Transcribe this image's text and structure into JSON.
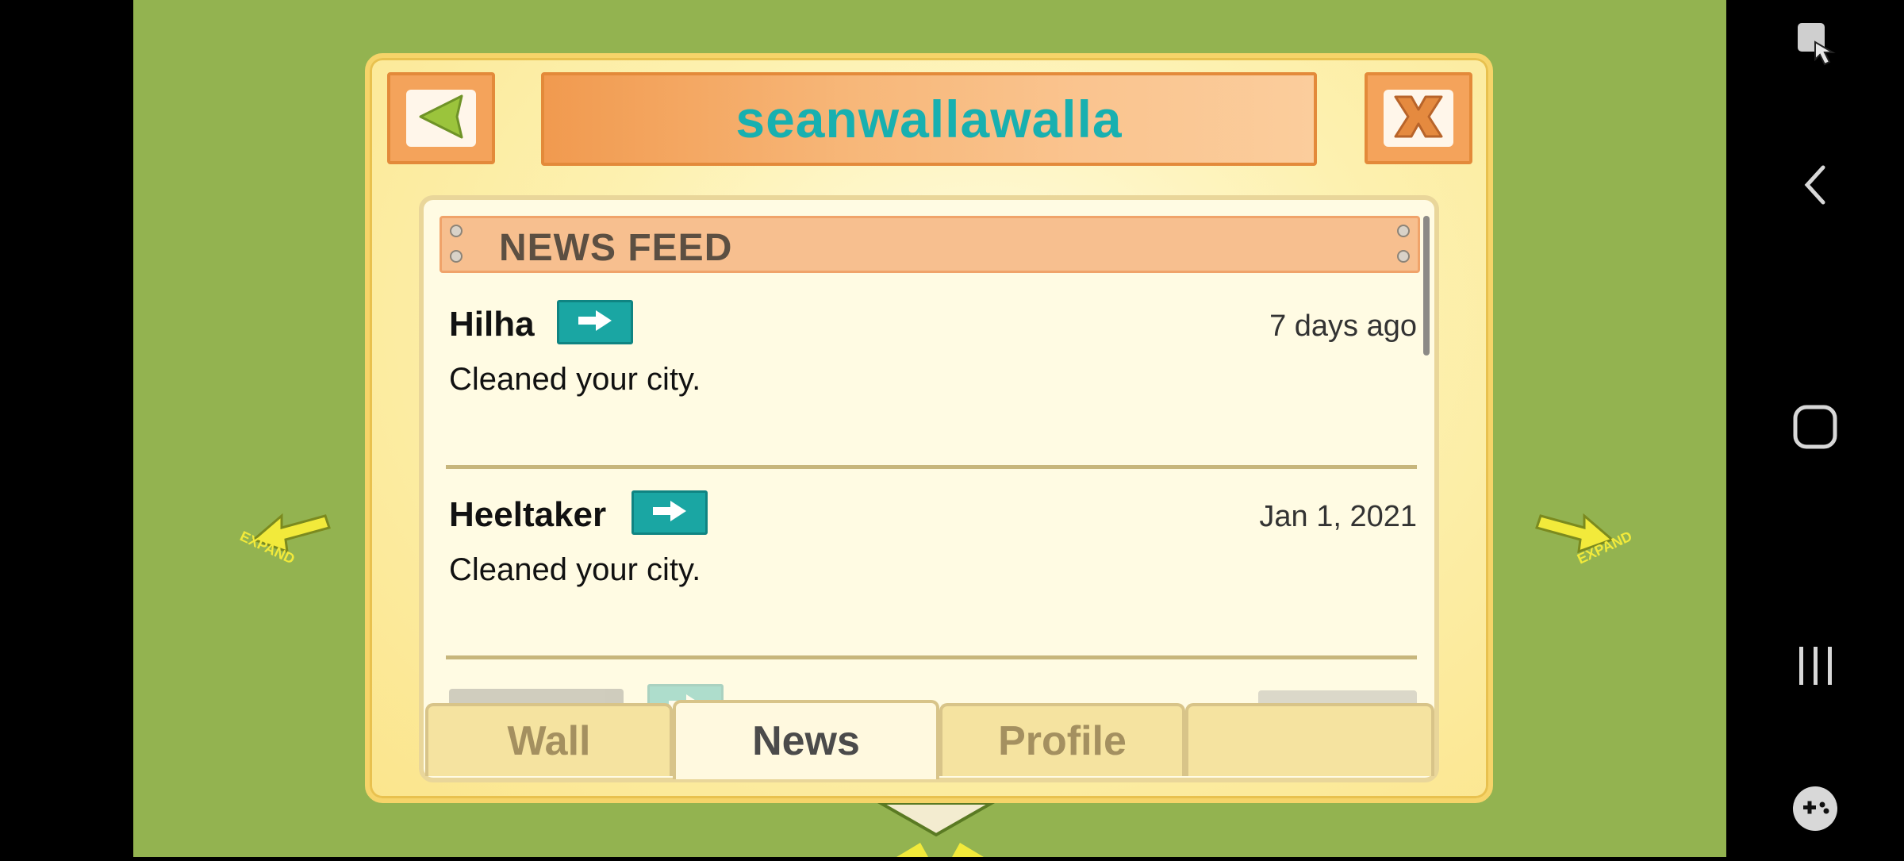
{
  "window": {
    "title": "seanwallawalla"
  },
  "map": {
    "expand_left": "EXPAND",
    "expand_right": "EXPAND"
  },
  "header": {
    "back_icon": "triangle-left-icon",
    "close_icon": "x-icon"
  },
  "feed": {
    "title": "NEWS FEED",
    "items": [
      {
        "name": "Hilha",
        "date": "7 days ago",
        "message": "Cleaned your city."
      },
      {
        "name": "Heeltaker",
        "date": "Jan 1, 2021",
        "message": "Cleaned your city."
      }
    ]
  },
  "tabs": [
    {
      "label": "Wall",
      "active": false
    },
    {
      "label": "News",
      "active": true
    },
    {
      "label": "Profile",
      "active": false
    },
    {
      "label": "",
      "active": false
    }
  ],
  "navbar": {
    "icons": [
      "screen-touch-icon",
      "back-chevron-icon",
      "home-square-icon",
      "recents-icon",
      "game-controller-icon"
    ]
  },
  "colors": {
    "background_green": "#93b350",
    "title_teal": "#18b0b0",
    "go_button_teal": "#1aa6a3",
    "header_orange": "#f4a35b"
  }
}
